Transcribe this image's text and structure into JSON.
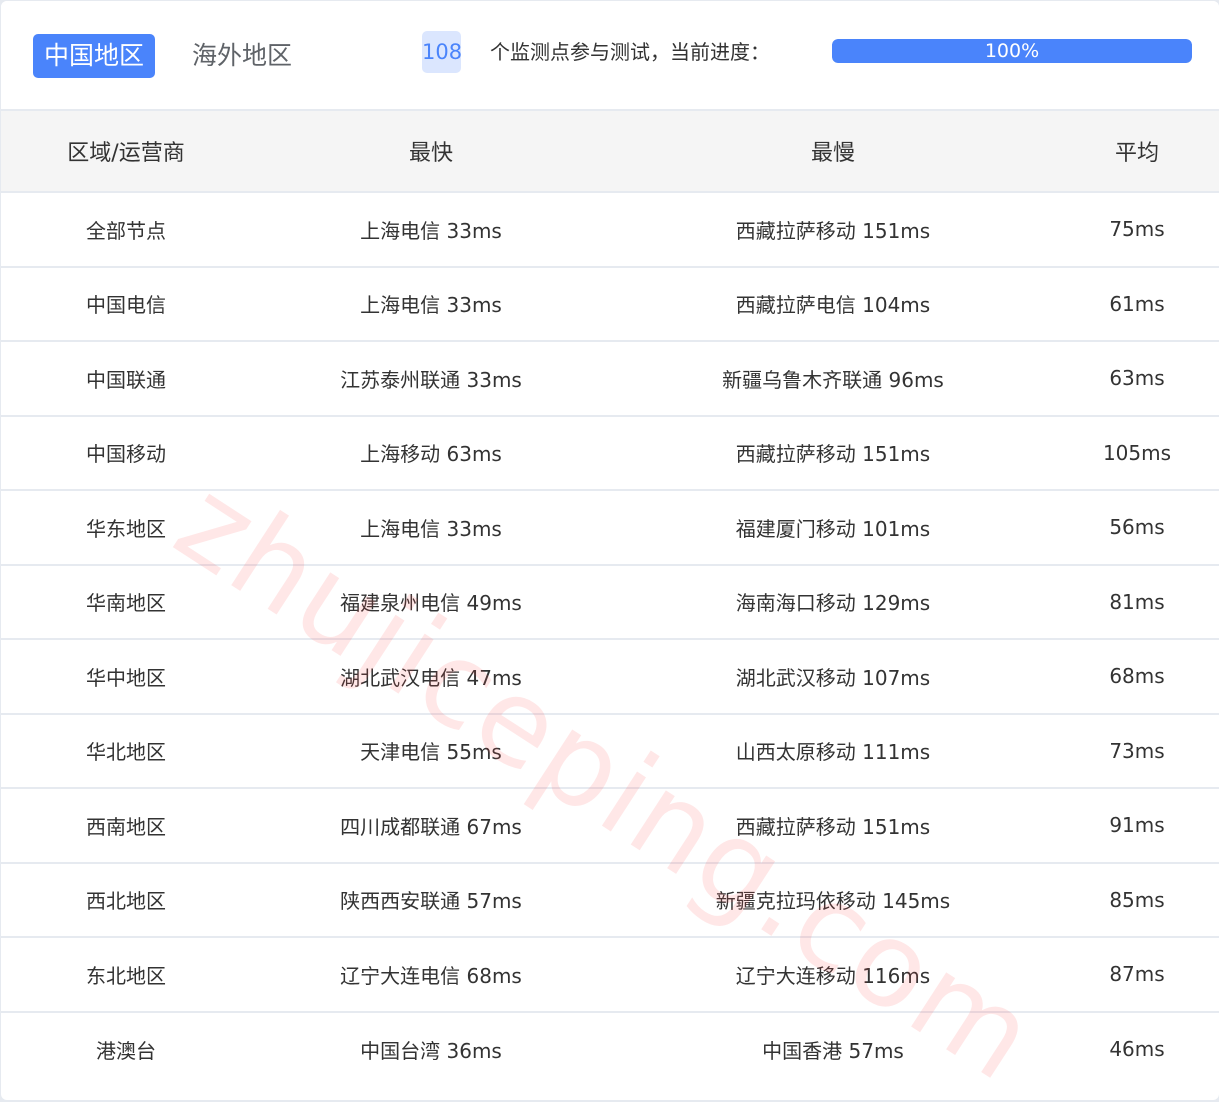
{
  "tabs": [
    {
      "label": "中国地区",
      "active": true
    },
    {
      "label": "海外地区",
      "active": false
    }
  ],
  "summary": {
    "monitor_count": "108",
    "text": "个监测点参与测试，当前进度：",
    "progress_percent": 100,
    "progress_label": "100%"
  },
  "colors": {
    "accent": "#4a84fb",
    "badge_bg": "#dbe6fe",
    "header_bg": "#f5f5f5",
    "divider": "#e6eaf0"
  },
  "table": {
    "headers": [
      "区域/运营商",
      "最快",
      "最慢",
      "平均"
    ],
    "rows": [
      [
        "全部节点",
        "上海电信 33ms",
        "西藏拉萨移动 151ms",
        "75ms"
      ],
      [
        "中国电信",
        "上海电信 33ms",
        "西藏拉萨电信 104ms",
        "61ms"
      ],
      [
        "中国联通",
        "江苏泰州联通 33ms",
        "新疆乌鲁木齐联通 96ms",
        "63ms"
      ],
      [
        "中国移动",
        "上海移动 63ms",
        "西藏拉萨移动 151ms",
        "105ms"
      ],
      [
        "华东地区",
        "上海电信 33ms",
        "福建厦门移动 101ms",
        "56ms"
      ],
      [
        "华南地区",
        "福建泉州电信 49ms",
        "海南海口移动 129ms",
        "81ms"
      ],
      [
        "华中地区",
        "湖北武汉电信 47ms",
        "湖北武汉移动 107ms",
        "68ms"
      ],
      [
        "华北地区",
        "天津电信 55ms",
        "山西太原移动 111ms",
        "73ms"
      ],
      [
        "西南地区",
        "四川成都联通 67ms",
        "西藏拉萨移动 151ms",
        "91ms"
      ],
      [
        "西北地区",
        "陕西西安联通 57ms",
        "新疆克拉玛依移动 145ms",
        "85ms"
      ],
      [
        "东北地区",
        "辽宁大连电信 68ms",
        "辽宁大连移动 116ms",
        "87ms"
      ],
      [
        "港澳台",
        "中国台湾 36ms",
        "中国香港 57ms",
        "46ms"
      ]
    ]
  },
  "watermark": "zhujiceping.com"
}
